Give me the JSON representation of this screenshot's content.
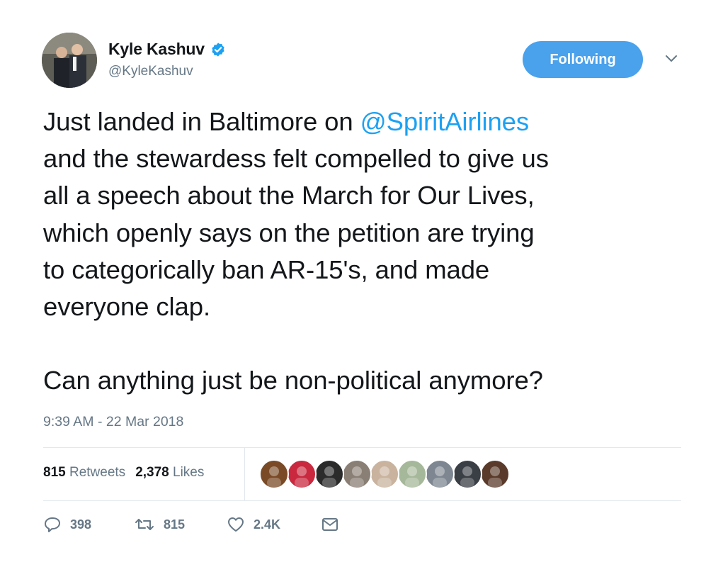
{
  "author": {
    "name": "Kyle Kashuv",
    "handle": "@KyleKashuv"
  },
  "follow_button": {
    "label": "Following"
  },
  "tweet": {
    "lines": [
      [
        "Just landed in Baltimore on ",
        "@SpiritAirlines"
      ],
      "and the stewardess felt compelled to give us",
      "all a speech about the March for Our Lives,",
      "which openly says on the petition are trying",
      "to categorically ban AR-15's, and made",
      "everyone clap."
    ],
    "line1_text": "Just landed in Baltimore on ",
    "mention": "@SpiritAirlines",
    "line2": "and the stewardess felt compelled to give us",
    "line3": "all a speech about the March for Our Lives,",
    "line4": "which openly says on the petition are trying",
    "line5": "to categorically ban AR-15's, and made",
    "line6": "everyone clap.",
    "line7": "Can anything just be non-political anymore?"
  },
  "timestamp": "9:39 AM - 22 Mar 2018",
  "stats": {
    "retweets_count": "815",
    "retweets_label": "Retweets",
    "likes_count": "2,378",
    "likes_label": "Likes"
  },
  "likers": [
    {
      "icon": "bear-avatar",
      "bg": "#7a4a26"
    },
    {
      "icon": "flag-avatar",
      "bg": "#c9283e"
    },
    {
      "icon": "bw-avatar",
      "bg": "#2b2b2b"
    },
    {
      "icon": "crowd-avatar",
      "bg": "#8a7f74"
    },
    {
      "icon": "man-avatar",
      "bg": "#c9b39e"
    },
    {
      "icon": "dog-avatar",
      "bg": "#a6b89a"
    },
    {
      "icon": "building-avatar",
      "bg": "#7e8791"
    },
    {
      "icon": "police-avatar",
      "bg": "#3a3e45"
    },
    {
      "icon": "woman-avatar",
      "bg": "#5a3a2a"
    }
  ],
  "actions": {
    "replies": "398",
    "retweets": "815",
    "likes": "2.4K"
  },
  "colors": {
    "link": "#1da1f2",
    "follow_bg": "#4aa1ec",
    "secondary_text": "#657786",
    "divider": "#e1e8ed"
  }
}
